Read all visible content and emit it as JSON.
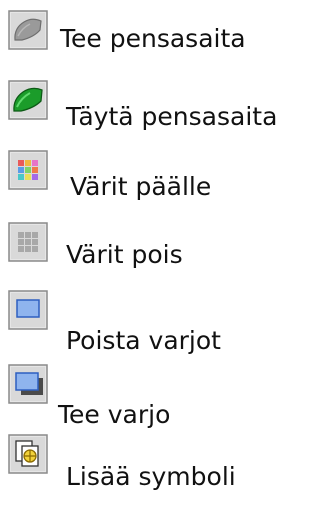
{
  "menu": {
    "items": [
      {
        "label": "Tee pensasaita",
        "icon": "hedge-outline-icon"
      },
      {
        "label": "Täytä pensasaita",
        "icon": "hedge-fill-icon"
      },
      {
        "label": "Värit päälle",
        "icon": "colors-on-icon"
      },
      {
        "label": "Värit pois",
        "icon": "colors-off-icon"
      },
      {
        "label": "Poista varjot",
        "icon": "remove-shadow-icon"
      },
      {
        "label": "Tee varjo",
        "icon": "make-shadow-icon"
      },
      {
        "label": "Lisää symboli",
        "icon": "insert-symbol-icon"
      }
    ]
  }
}
